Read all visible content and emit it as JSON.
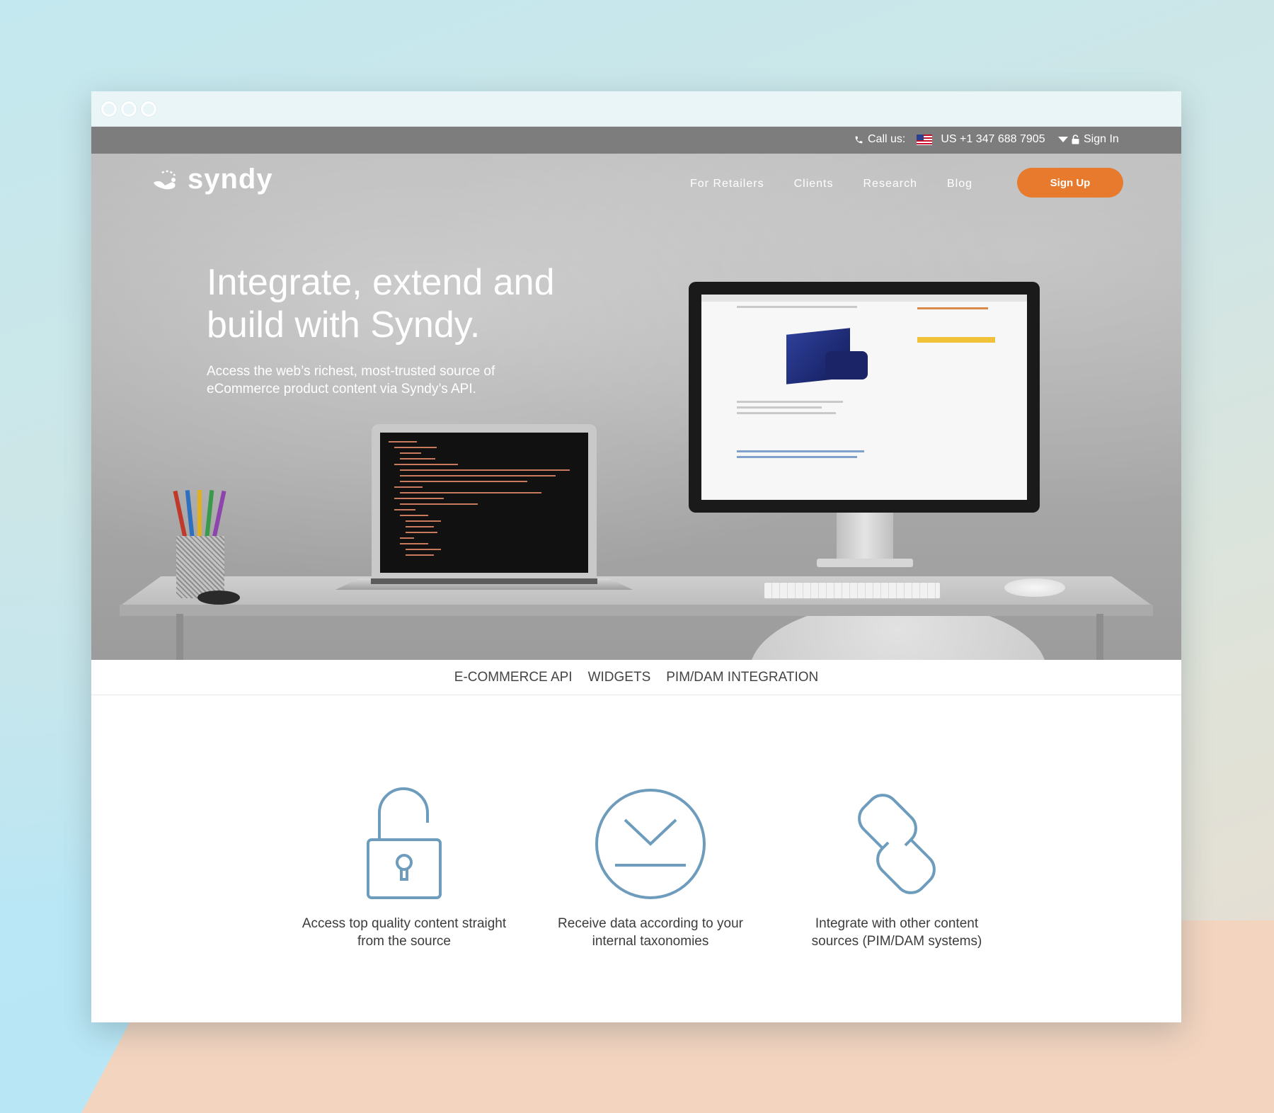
{
  "topbar": {
    "call_label": "Call us:",
    "phone": "US +1 347 688 7905",
    "signin_label": "Sign In"
  },
  "header": {
    "logo_text": "syndy",
    "nav": [
      "For Retailers",
      "Clients",
      "Research",
      "Blog"
    ],
    "signup_label": "Sign Up"
  },
  "hero": {
    "headline": "Integrate, extend and build with Syndy.",
    "subhead": "Access the web’s richest, most-trusted source of eCommerce product content via Syndy’s API."
  },
  "tabs": [
    "E-COMMERCE API",
    "WIDGETS",
    "PIM/DAM INTEGRATION"
  ],
  "features": [
    {
      "icon": "unlocked-padlock-icon",
      "text": "Access top quality content straight from the source"
    },
    {
      "icon": "download-circle-icon",
      "text": "Receive data according to your internal taxonomies"
    },
    {
      "icon": "chain-link-icon",
      "text": "Integrate with other content sources (PIM/DAM systems)"
    }
  ],
  "colors": {
    "accent": "#e77a2c",
    "icon_stroke": "#6d9cbc",
    "topbar": "#7d7d7d"
  }
}
